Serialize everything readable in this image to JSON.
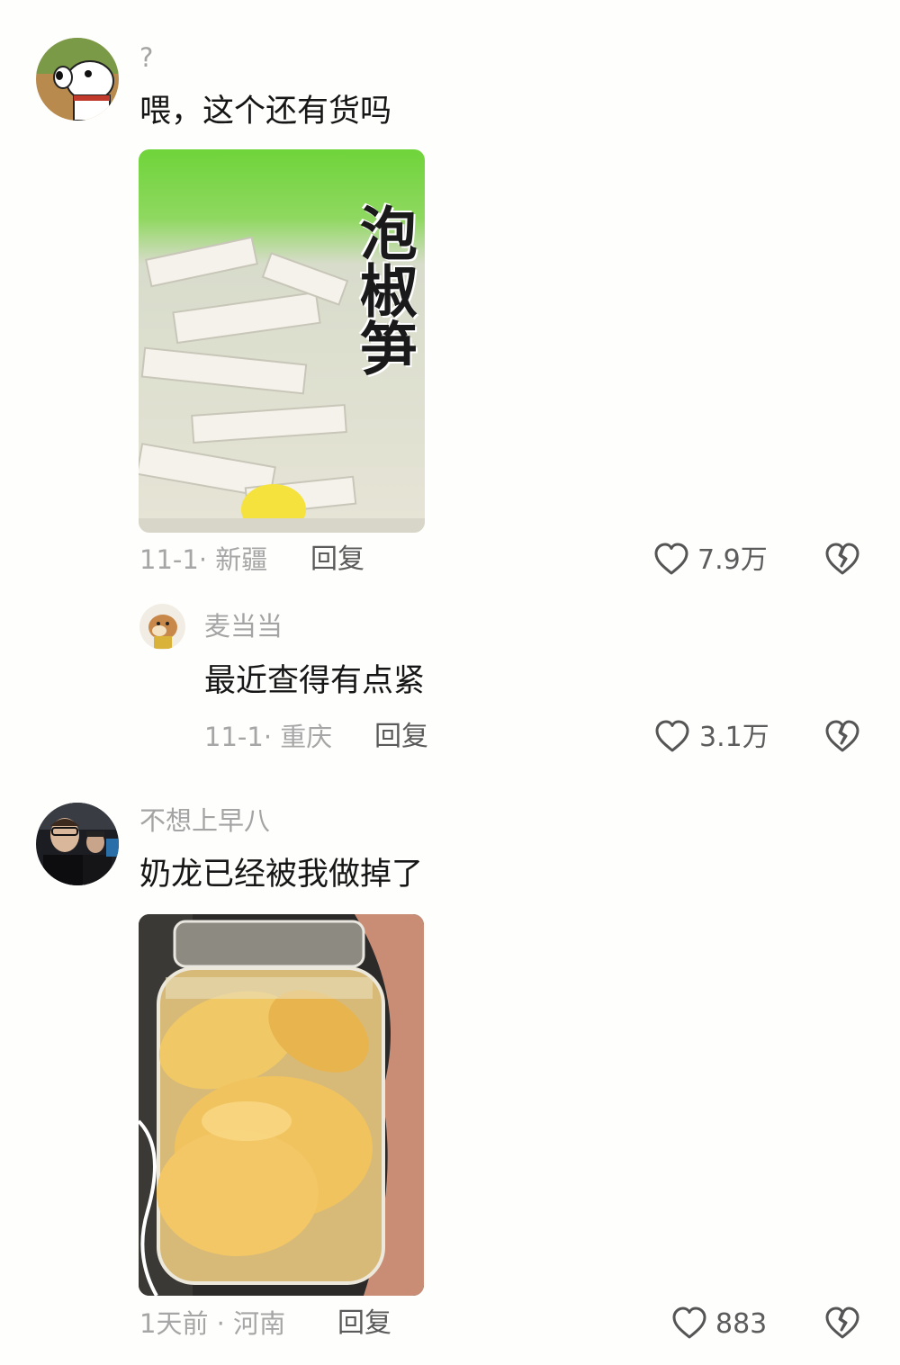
{
  "comments": [
    {
      "username": "?",
      "text": "喂，这个还有货吗",
      "image_text": "泡椒笋",
      "date": "11-1",
      "location": "新疆",
      "reply_label": "回复",
      "likes": "7.9万",
      "replies": [
        {
          "username": "麦当当",
          "text": "最近查得有点紧",
          "date": "11-1",
          "location": "重庆",
          "reply_label": "回复",
          "likes": "3.1万"
        }
      ]
    },
    {
      "username": "不想上早八",
      "text": "奶龙已经被我做掉了",
      "date": "1天前",
      "location": "河南",
      "reply_label": "回复",
      "likes": "883"
    }
  ],
  "icons": {
    "like": "heart-outline-icon",
    "dislike": "broken-heart-icon"
  },
  "colors": {
    "background": "#fefefc",
    "text_primary": "#161616",
    "text_secondary": "#a6a6a6",
    "action": "#5a5a5a"
  }
}
